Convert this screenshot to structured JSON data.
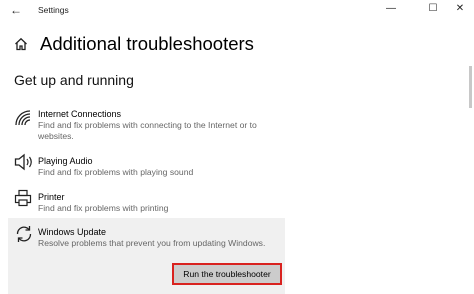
{
  "window": {
    "title": "Settings",
    "back_glyph": "←",
    "minimize_glyph": "—",
    "maximize_glyph": "☐",
    "close_glyph": "✕"
  },
  "page": {
    "title": "Additional troubleshooters",
    "icon": "home-icon"
  },
  "section": {
    "title": "Get up and running"
  },
  "items": [
    {
      "name": "Internet Connections",
      "description": "Find and fix problems with connecting to the Internet or to websites.",
      "icon": "wifi-icon"
    },
    {
      "name": "Playing Audio",
      "description": "Find and fix problems with playing sound",
      "icon": "speaker-icon"
    },
    {
      "name": "Printer",
      "description": "Find and fix problems with printing",
      "icon": "printer-icon"
    },
    {
      "name": "Windows Update",
      "description": "Resolve problems that prevent you from updating Windows.",
      "icon": "refresh-icon",
      "selected": true
    }
  ],
  "actions": {
    "run_label": "Run the troubleshooter"
  },
  "colors": {
    "highlight_border": "#d9221f",
    "selected_background": "#f0f0f0",
    "button_background": "#cccccc"
  }
}
